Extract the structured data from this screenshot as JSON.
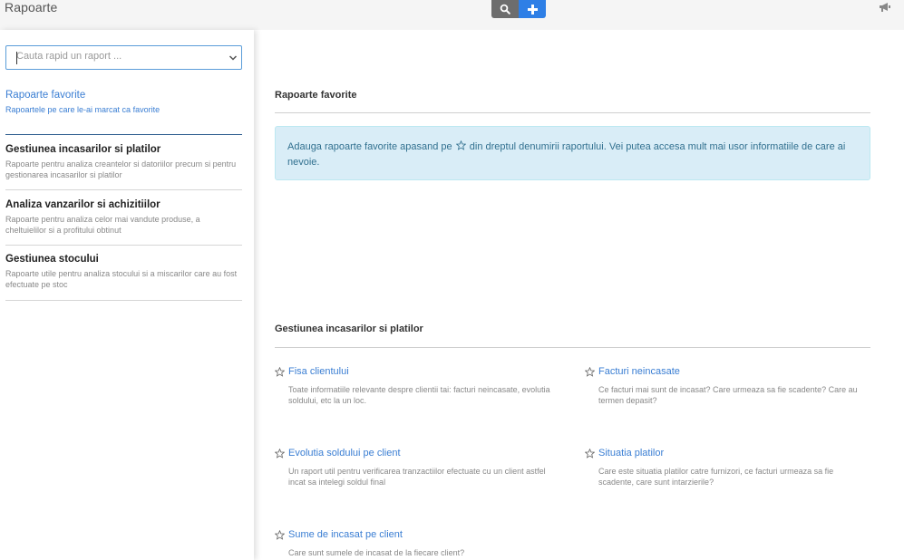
{
  "app": {
    "title": "Rapoarte"
  },
  "search": {
    "placeholder": "Cauta rapid un raport ..."
  },
  "sidebar": {
    "categories": [
      {
        "title": "Rapoarte favorite",
        "desc": "Rapoartele pe care le-ai marcat ca favorite"
      },
      {
        "title": "Gestiunea incasarilor si platilor",
        "desc": "Rapoarte pentru analiza creantelor si datoriilor precum si pentru gestionarea incasarilor si platilor"
      },
      {
        "title": "Analiza vanzarilor si achizitiilor",
        "desc": "Rapoarte pentru analiza celor mai vandute produse, a cheltuielilor si a profitului obtinut"
      },
      {
        "title": "Gestiunea stocului",
        "desc": "Rapoarte utile pentru analiza stocului si a miscarilor care au fost efectuate pe stoc"
      }
    ]
  },
  "main": {
    "favorites": {
      "title": "Rapoarte favorite",
      "alert_before": "Adauga rapoarte favorite apasand pe ",
      "alert_after": " din dreptul denumirii raportului. Vei putea accesa mult mai usor informatiile de care ai nevoie."
    },
    "payments": {
      "title": "Gestiunea incasarilor si platilor",
      "reports": [
        {
          "name": "Fisa clientului",
          "desc": "Toate informatiile relevante despre clientii tai: facturi neincasate, evolutia soldului, etc la un loc."
        },
        {
          "name": "Facturi neincasate",
          "desc": "Ce facturi mai sunt de incasat? Care urmeaza sa fie scadente? Care au termen depasit?"
        },
        {
          "name": "Evolutia soldului pe client",
          "desc": "Un raport util pentru verificarea tranzactiilor efectuate cu un client astfel incat sa intelegi soldul final"
        },
        {
          "name": "Situatia platilor",
          "desc": "Care este situatia platilor catre furnizori, ce facturi urmeaza sa fie scadente, care sunt intarzierile?"
        },
        {
          "name": "Sume de incasat pe client",
          "desc": "Care sunt sumele de incasat de la fiecare client?"
        }
      ]
    }
  },
  "colors": {
    "accent": "#3a7ed3",
    "add_button": "#2e7fe6",
    "search_button": "#6d6d6d",
    "alert_bg": "#d9edf7"
  }
}
